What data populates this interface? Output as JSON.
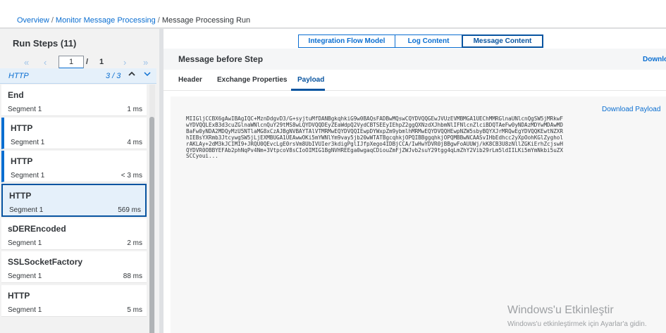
{
  "breadcrumb": {
    "items": [
      "Overview",
      "Monitor Message Processing",
      "Message Processing Run"
    ],
    "separator": "/"
  },
  "left": {
    "title": "Run Steps (11)",
    "pager": {
      "first": "«",
      "prev": "‹",
      "current": "1",
      "slash": "/",
      "total": "1",
      "next": "›",
      "last": "»"
    },
    "filter": {
      "text": "HTTP",
      "count": "3 / 3",
      "up_icon": "chevron-up-icon",
      "down_icon": "chevron-down-icon"
    },
    "steps": [
      {
        "name": "End",
        "segment": "Segment 1",
        "duration": "1 ms"
      },
      {
        "name": "HTTP",
        "segment": "Segment 1",
        "duration": "4 ms"
      },
      {
        "name": "HTTP",
        "segment": "Segment 1",
        "duration": "< 3 ms"
      },
      {
        "name": "HTTP",
        "segment": "Segment 1",
        "duration": "569 ms"
      },
      {
        "name": "sDEREncoded",
        "segment": "Segment 1",
        "duration": "2 ms"
      },
      {
        "name": "SSLSocketFactory",
        "segment": "Segment 1",
        "duration": "88 ms"
      },
      {
        "name": "HTTP",
        "segment": "Segment 1",
        "duration": "5 ms"
      }
    ]
  },
  "right": {
    "segments": [
      "Integration Flow Model",
      "Log Content",
      "Message Content"
    ],
    "title": "Message before Step",
    "download_partial": "Downlo",
    "tabs": [
      "Header",
      "Exchange Properties",
      "Payload"
    ],
    "download_payload": "Download Payload",
    "payload": "MIIGljCCBX6gAwIBAgIQC+MznDdgvD3/G+syjtuMfDANBgkqhkiG9w0BAQsFADBwMQswCQYDVQQGEwJVUzEVMBMGA1UEChMMRGlnaUNlcnQgSW5jMRkwF\nwYDVQQLExB3d3cuZGlnaWNlcnQuY29tMS8wLQYDVQQDEyZEaWdpQ2VydCBTSEEyIEhpZ2ggQXNzdXJhbmNlIFNlcnZlciBDQTAeFw0yNDAzMDYwMDAwMD\nBaFw0yNDA2MDQyMzU5NTlaMG8xCzAJBgNVBAYTAlVTMRMwEQYDVQQIEwpDYWxpZm9ybmlhMRMwEQYDVQQHEwpNZW5sbyBQYXJrMRQwEgYDVQQKEwtNZXR\nhIEBsYXRmb3JtcywgSW5jLjEXMBUGA1UEAwwOKi5mYWNlYm9vay5jb20wWTATBgcqhkjOPQIBBggqhkjOPQMBBwNCAASvIHbEdhcc2yXpOohKGlZyghol\nrAKLAy+2dM3kJCIMI9+JRQU0QEvcLgE0rsVm8UbIVUIer3kdigPglIJfpXego4IDBjCCA/IwHwYDVR0jBBgwFoAUUWj/kK8CB3U8zNllZGKiErhZcjswH\nQYDVR0OBBYEFAb2phNqPv4Nm+3VtpcoV8sCIoOIMIG1BgNVHREEga0wgaqCDiouZmFjZWJvb2suY29tgg4qLmZhY2Vib29rLm5ldIILKi5mYmNkbi5uZX\nSCCyoui..."
  },
  "watermark": {
    "title": "Windows'u Etkinleştir",
    "subtitle": "Windows'u etkinleştirmek için Ayarlar'a gidin."
  }
}
